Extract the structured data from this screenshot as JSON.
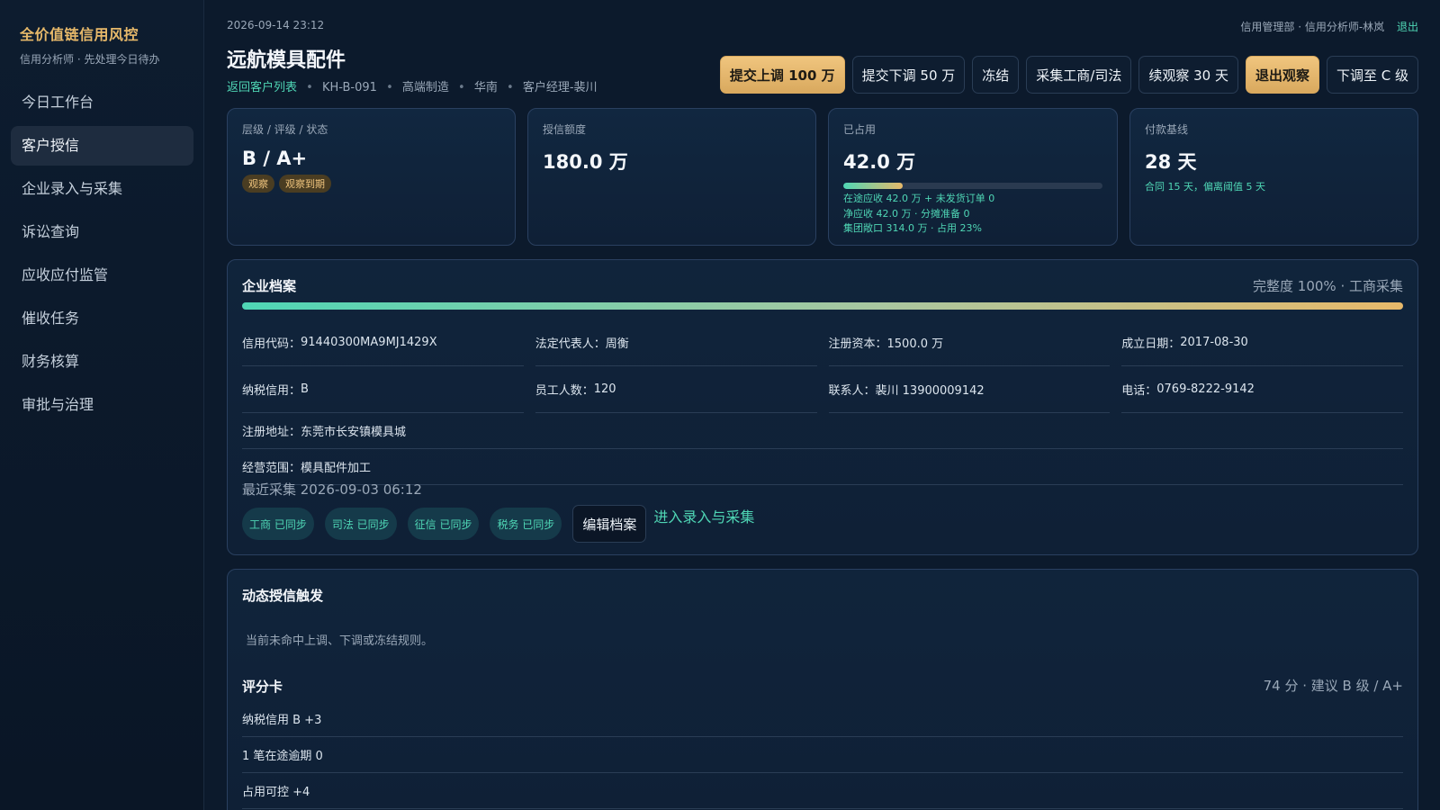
{
  "app": {
    "brand": "全价值链信用风控",
    "brand_sub": "信用分析师 · 先处理今日待办"
  },
  "nav": [
    {
      "label": "今日工作台",
      "active": false
    },
    {
      "label": "客户授信",
      "active": true
    },
    {
      "label": "企业录入与采集",
      "active": false
    },
    {
      "label": "诉讼查询",
      "active": false
    },
    {
      "label": "应收应付监管",
      "active": false
    },
    {
      "label": "催收任务",
      "active": false
    },
    {
      "label": "财务核算",
      "active": false
    },
    {
      "label": "审批与治理",
      "active": false
    }
  ],
  "header": {
    "timestamp": "2026-09-14 23:12",
    "user": "信用管理部 · 信用分析师-林岚",
    "logout": "退出",
    "title": "远航模具配件",
    "back": "返回客户列表",
    "crumbs": [
      "KH-B-091",
      "高端制造",
      "华南",
      "客户经理-裴川"
    ]
  },
  "actions": [
    {
      "label": "提交上调 100 万",
      "style": "gold"
    },
    {
      "label": "提交下调 50 万",
      "style": "normal"
    },
    {
      "label": "冻结",
      "style": "normal"
    },
    {
      "label": "采集工商/司法",
      "style": "normal"
    },
    {
      "label": "续观察 30 天",
      "style": "normal"
    },
    {
      "label": "退出观察",
      "style": "gold"
    },
    {
      "label": "下调至 C 级",
      "style": "normal"
    }
  ],
  "kpis": {
    "level": {
      "label": "层级 / 评级 / 状态",
      "value": "B / A+",
      "badges": [
        "观察",
        "观察到期"
      ]
    },
    "limit": {
      "label": "授信额度",
      "value": "180.0 万"
    },
    "used": {
      "label": "已占用",
      "value": "42.0 万",
      "usage_fraction": 0.23,
      "notes": [
        "在途应收 42.0 万 + 未发货订单 0",
        "净应收 42.0 万 · 分摊准备 0",
        "集团敞口 314.0 万 · 占用 23%"
      ]
    },
    "terms": {
      "label": "付款基线",
      "value": "28 天",
      "note": "合同 15 天，偏离阈值 5 天"
    }
  },
  "profile": {
    "title": "企业档案",
    "completeness": "完整度 100% · 工商采集",
    "completeness_fraction": 1.0,
    "fields": [
      {
        "k": "信用代码：",
        "v": "91440300MA9MJ1429X"
      },
      {
        "k": "法定代表人：",
        "v": "周衡"
      },
      {
        "k": "注册资本：",
        "v": "1500.0 万"
      },
      {
        "k": "成立日期：",
        "v": "2017-08-30"
      },
      {
        "k": "纳税信用：",
        "v": "B"
      },
      {
        "k": "员工人数：",
        "v": "120"
      },
      {
        "k": "联系人：",
        "v": "裴川 13900009142"
      },
      {
        "k": "电话：",
        "v": "0769-8222-9142"
      }
    ],
    "address": {
      "k": "注册地址：",
      "v": "东莞市长安镇模具城"
    },
    "scope": {
      "k": "经营范围：",
      "v": "模具配件加工"
    },
    "last_collect": "最近采集 2026-09-03 06:12",
    "sync_chips": [
      "工商 已同步",
      "司法 已同步",
      "征信 已同步",
      "税务 已同步"
    ],
    "edit_label": "编辑档案",
    "enter_link": "进入录入与采集"
  },
  "dynamic": {
    "title": "动态授信触发",
    "desc": "当前未命中上调、下调或冻结规则。",
    "scorecard_title": "评分卡",
    "scorecard_summary": "74 分 · 建议 B 级 / A+",
    "items": [
      "纳税信用 B +3",
      "1 笔在途逾期 0",
      "占用可控 +4"
    ]
  },
  "colors": {
    "accent": "#4fd6b5",
    "gold": "#e7b96a",
    "background": "#0c1a2c"
  }
}
